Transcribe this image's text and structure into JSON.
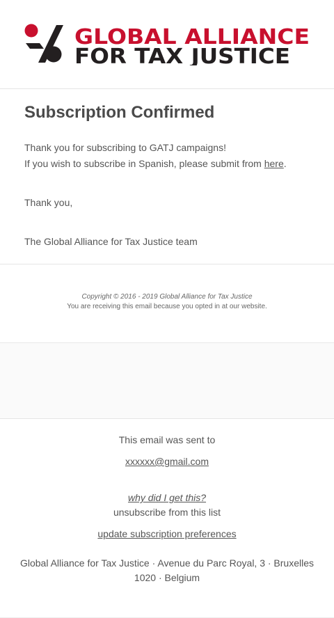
{
  "logo": {
    "line1": "GLOBAL ALLIANCE",
    "line2": "FOR TAX JUSTICE",
    "accent_color": "#c8102e",
    "dark_color": "#231f20"
  },
  "main": {
    "title": "Subscription Confirmed",
    "line1": "Thank you for subscribing to GATJ campaigns!",
    "line2_prefix": "If you wish to subscribe in Spanish, please submit from ",
    "line2_link": "here",
    "line2_suffix": ".",
    "thanks": "Thank you,",
    "team": "The Global Alliance for Tax Justice team"
  },
  "footer": {
    "copyright": "Copyright © 2016 - 2019 Global Alliance for Tax Justice",
    "optin": "You are receiving this email because you opted in at our website.",
    "sent_to": "This email was sent to",
    "email": "xxxxxx@gmail.com",
    "why": "why did I get this?",
    "unsubscribe": "unsubscribe from this list",
    "update_prefs": "update subscription preferences",
    "address_line1": "Global Alliance for Tax Justice · Avenue du Parc Royal, 3 · Bruxelles",
    "address_line2": "1020 · Belgium"
  }
}
